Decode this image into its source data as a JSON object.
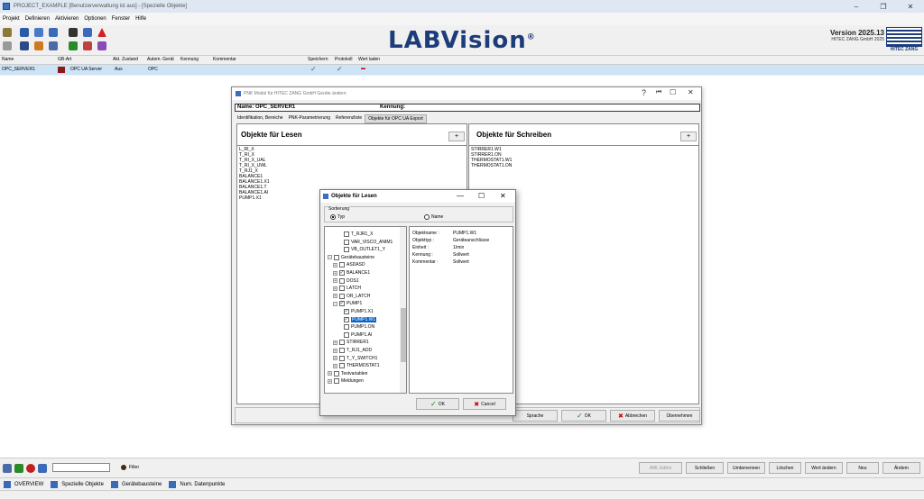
{
  "window": {
    "title": "PROJECT_EXAMPLE [Benutzerverwaltung ist aus] - [Spezielle Objekte]",
    "minimize": "–",
    "restore": "❐",
    "close": "✕"
  },
  "menu": [
    "Projekt",
    "Definieren",
    "Aktivieren",
    "Optionen",
    "Fenster",
    "Hilfe"
  ],
  "brand": {
    "logo": "LABVision",
    "registered": "®",
    "version": "Version 2025.13",
    "company": "HITEC ZANG GmbH 2025",
    "hz_label": "HITEC ZANG"
  },
  "grid": {
    "headers": [
      "Name",
      "GB-Art",
      "Akt. Zustand",
      "Autom. Gerät",
      "Kennung",
      "Kommentar",
      "Speichern",
      "Protokoll",
      "Wert laden"
    ],
    "row": {
      "name": "OPC_SERVER1",
      "gb_art": "OPC UA Server",
      "zustand": "Aus",
      "autom": "OPC",
      "speichern": "✓",
      "protokoll": "✓",
      "wert_laden": "▬"
    }
  },
  "pnk": {
    "title": "PNK Modul für HITEC ZANG GmbH Geräte ändern",
    "name_label": "Name: OPC_SERVER1",
    "kennung_label": "Kennung:",
    "help": "?",
    "back": "⏮",
    "maximize": "☐",
    "close": "✕",
    "tabs": [
      "Identifikation, Bereiche",
      "PNK-Parametrierung",
      "Referenzliste",
      "Objekte für OPC UA Export"
    ],
    "read_title": "Objekte für Lesen",
    "write_title": "Objekte für Schreiben",
    "plus": "+",
    "read_items": [
      "L_RI_X",
      "T_RI_X",
      "T_RI_X_UAL",
      "T_RI_X_UWL",
      "T_RJ1_X",
      "BALANCE1",
      "BALANCE1.X1",
      "BALANCE1.T",
      "BALANCE1.AI",
      "PUMP1.X1"
    ],
    "write_items": [
      "STIRRER1.W1",
      "STIRRER1.ON",
      "THERMOSTAT1.W1",
      "THERMOSTAT1.ON"
    ],
    "buttons": {
      "sprache": "Sprache",
      "ok": "OK",
      "abbrechen": "Abbrechen",
      "uebernehmen": "Übernehmen"
    }
  },
  "dialog": {
    "title": "Objekte für Lesen",
    "minimize": "—",
    "maximize": "☐",
    "close": "✕",
    "sort_label": "Sortierung",
    "sort_typ": "Typ",
    "sort_name": "Name",
    "tree": [
      {
        "label": "T_RJR1_X",
        "indent": 3,
        "checked": false,
        "exp": ""
      },
      {
        "label": "VAR_VISCO_ANIM1",
        "indent": 3,
        "checked": false,
        "exp": ""
      },
      {
        "label": "VB_OUTLET1_Y",
        "indent": 3,
        "checked": false,
        "exp": ""
      },
      {
        "label": "Gerätebausteine",
        "indent": 0,
        "checked": false,
        "exp": "−"
      },
      {
        "label": "ASDASD",
        "indent": 1,
        "checked": false,
        "exp": "+"
      },
      {
        "label": "BALANCE1",
        "indent": 1,
        "checked": true,
        "exp": "+"
      },
      {
        "label": "DOS1",
        "indent": 1,
        "checked": false,
        "exp": "+"
      },
      {
        "label": "LATCH",
        "indent": 1,
        "checked": false,
        "exp": "+"
      },
      {
        "label": "OR_LATCH",
        "indent": 1,
        "checked": false,
        "exp": "+"
      },
      {
        "label": "PUMP1",
        "indent": 1,
        "checked": true,
        "exp": "−"
      },
      {
        "label": "PUMP1.X1",
        "indent": 3,
        "checked": true,
        "exp": ""
      },
      {
        "label": "PUMP1.W1",
        "indent": 3,
        "checked": true,
        "exp": "",
        "selected": true
      },
      {
        "label": "PUMP1.ON",
        "indent": 3,
        "checked": false,
        "exp": ""
      },
      {
        "label": "PUMP1.AI",
        "indent": 3,
        "checked": false,
        "exp": ""
      },
      {
        "label": "STIRRER1",
        "indent": 1,
        "checked": false,
        "exp": "+"
      },
      {
        "label": "T_RJ1_ADD",
        "indent": 1,
        "checked": false,
        "exp": "+"
      },
      {
        "label": "T_Y_SWITCH1",
        "indent": 1,
        "checked": false,
        "exp": "+"
      },
      {
        "label": "THERMOSTAT1",
        "indent": 1,
        "checked": false,
        "exp": "+"
      },
      {
        "label": "Textvariablen",
        "indent": 0,
        "checked": false,
        "exp": "+"
      },
      {
        "label": "Meldungen",
        "indent": 0,
        "checked": false,
        "exp": "+"
      }
    ],
    "details": [
      {
        "key": "Objektname :",
        "value": "PUMP1.W1"
      },
      {
        "key": "Objekttyp :",
        "value": "Geräteanschlüsse"
      },
      {
        "key": "Einheit :",
        "value": "1/min"
      },
      {
        "key": "Kennung :",
        "value": "Sollwert"
      },
      {
        "key": "Kommentar :",
        "value": "Sollwert"
      }
    ],
    "ok": "OK",
    "cancel": "Cancel"
  },
  "bottom": {
    "filter_label": "Filter",
    "filter_value": "",
    "buttons": [
      "AML Editor",
      "Schließen",
      "Umbenennen",
      "Löschen",
      "Wert ändern",
      "Neu",
      "Ändern"
    ]
  },
  "tabs": [
    "OVERVIEW",
    "Spezielle Objekte",
    "Gerätebausteine",
    "Num. Datenpunkte"
  ],
  "colors": {
    "selection": "#cde4f7",
    "check": "#1b7e1b",
    "brand": "#1c3d7a",
    "dialog_select": "#0a64c8"
  }
}
